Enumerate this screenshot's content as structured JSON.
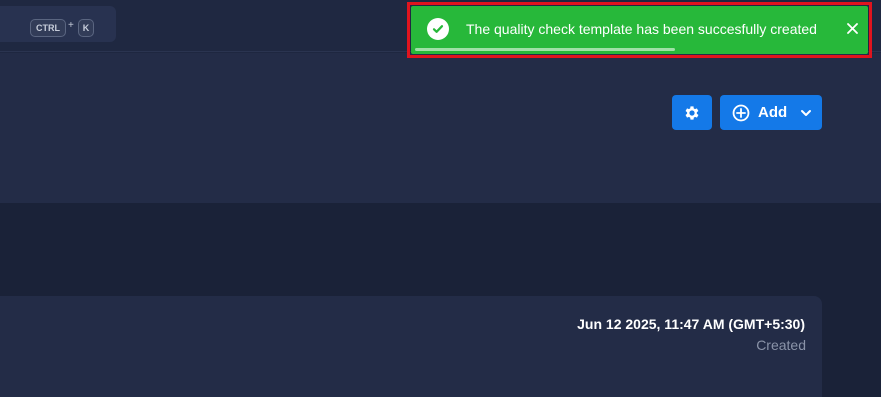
{
  "topbar": {
    "shortcut": {
      "ctrl_label": "CTRL",
      "plus": "+",
      "key_label": "K"
    }
  },
  "header": {
    "settings_icon": "gear-icon",
    "add_button": {
      "label": "Add",
      "icon": "plus-circle-icon",
      "dropdown_icon": "chevron-down-icon"
    }
  },
  "card": {
    "created_date": "Jun 12 2025, 11:47 AM (GMT+5:30)",
    "created_label": "Created"
  },
  "toast": {
    "message": "The quality check template has been succesfully created",
    "status": "success",
    "icon": "check-circle-icon",
    "close_icon": "close-icon",
    "progress_fraction": 0.58
  },
  "colors": {
    "background": "#1e2740",
    "accent": "#1479e8",
    "success": "#27b83a",
    "highlight": "#e0141e"
  }
}
